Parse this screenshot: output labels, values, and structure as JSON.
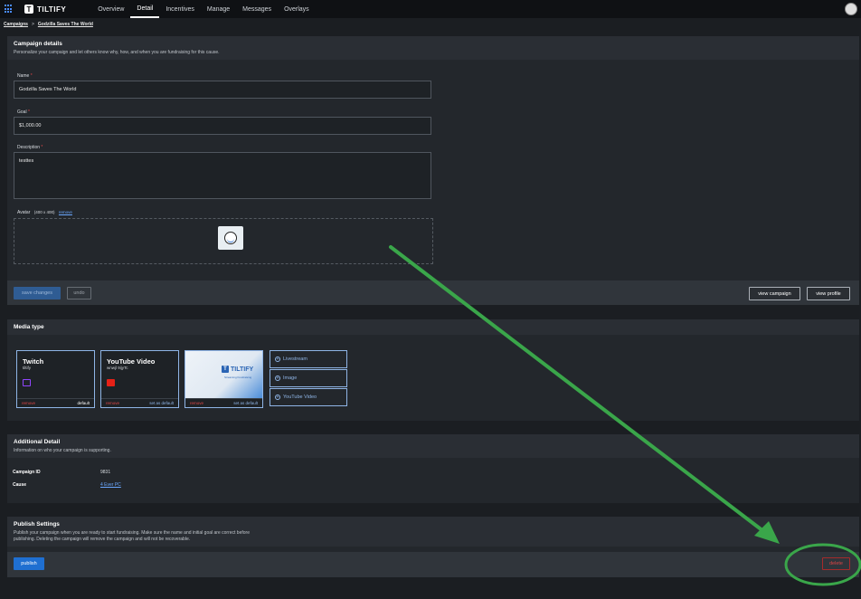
{
  "topbar": {
    "brand": "TILTIFY",
    "brand_mark": "T",
    "nav": [
      {
        "label": "Overview"
      },
      {
        "label": "Detail"
      },
      {
        "label": "Incentives"
      },
      {
        "label": "Manage"
      },
      {
        "label": "Messages"
      },
      {
        "label": "Overlays"
      }
    ]
  },
  "breadcrumb": {
    "root": "Campaigns",
    "sep": ">",
    "current": "Godzilla Saves The World"
  },
  "campaign": {
    "title": "Campaign details",
    "subtitle": "Personalize your campaign and let others know why, how, and when you are fundraising for this cause.",
    "name_label": "Name",
    "name_value": "Godzilla Saves The World",
    "goal_label": "Goal",
    "goal_value": "$1,000.00",
    "description_label": "Description",
    "description_value": "testtes",
    "required_mark": "*",
    "avatar_label": "Avatar",
    "avatar_size": "(400 x 400)",
    "avatar_remove": "remove",
    "save_label": "save changes",
    "undo_label": "undo",
    "view_campaign_label": "view campaign",
    "view_profile_label": "view profile"
  },
  "media": {
    "title": "Media type",
    "cards": [
      {
        "title": "Twitch",
        "sub": "tiltify",
        "remove": "remove",
        "status": "default"
      },
      {
        "title": "YouTube Video",
        "sub": "wnwjl 9ijyTc",
        "remove": "remove",
        "status": "set as default"
      },
      {
        "remove": "remove",
        "status": "set as default"
      }
    ],
    "banner_brand": "TILTIFY",
    "banner_mark": "T",
    "banner_sub": "Streaming Fundraising",
    "add_items": [
      {
        "plus": "+",
        "label": "Livestream"
      },
      {
        "plus": "+",
        "label": "Image"
      },
      {
        "plus": "+",
        "label": "YouTube Video"
      }
    ],
    "colors": {
      "twitch": "#9146ff",
      "youtube": "#e62117"
    }
  },
  "additional": {
    "title": "Additional Detail",
    "subtitle": "Information on who your campaign is supporting.",
    "id_label": "Campaign ID",
    "id_value": "9831",
    "cause_label": "Cause",
    "cause_value": "4 Ever PC"
  },
  "publish": {
    "title": "Publish Settings",
    "subtitle_1": "Publish your campaign when you are ready to start fundraising. Make sure the name and initial goal are correct before",
    "subtitle_2": "publishing. Deleting the campaign will remove the campaign and will not be recoverable.",
    "publish_label": "publish",
    "delete_label": "delete"
  },
  "annotation_color": "#3aa64a"
}
